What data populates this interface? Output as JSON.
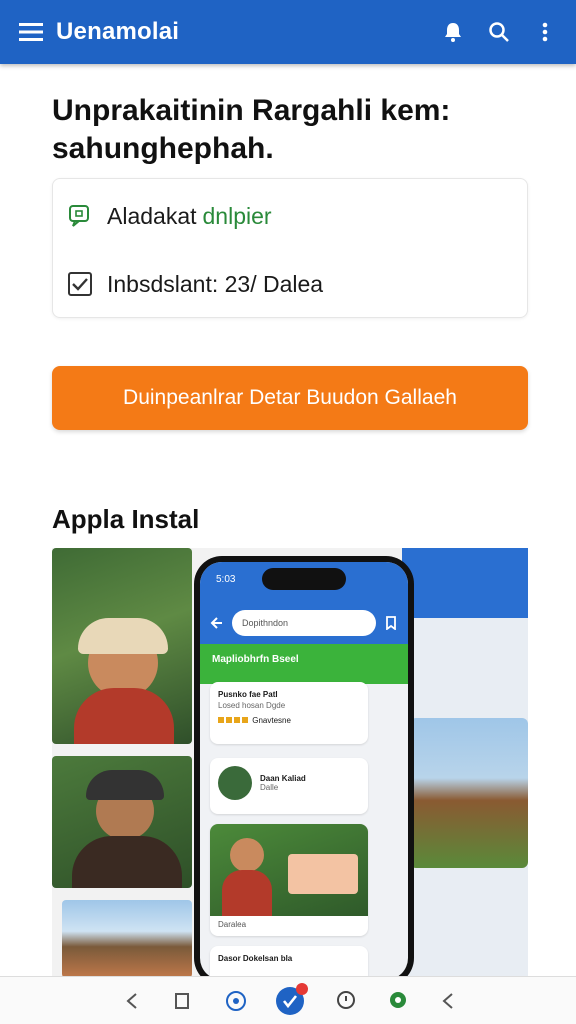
{
  "appbar": {
    "title": "Uenamolai",
    "menu_icon": "menu-icon",
    "actions": [
      "notification-bell-icon",
      "search-icon",
      "more-vert-icon"
    ],
    "color": "#1f63c4"
  },
  "headline": "Unprakaitinin Rargahli kem: sahunghephah.",
  "info": {
    "row1_label": "Aladakat",
    "row1_value": "dnlpier",
    "row1_icon": "chat-icon",
    "row2_text": "Inbsdslant: 23/ Dalea",
    "row2_icon": "checkbox-icon"
  },
  "cta": {
    "label": "Duinpeanlrar Detar Buudon Gallaeh",
    "color": "#f47a16"
  },
  "section_title": "Appla Instal",
  "phone": {
    "status_time": "5:03",
    "search_text": "Dopithndon",
    "green_banner": "Mapliobhrfn Bseel",
    "card1_title": "Pusnko fae Patl",
    "card1_sub": "Losed hosan Dgde",
    "card1_rating": "Gnavtesne",
    "card2_title": "Daan Kaliad",
    "card2_sub": "Dalle",
    "card3_caption": "Daralea",
    "card4_title": "Dasor Dokelsan bla"
  },
  "navbar": {
    "items": [
      "back-icon",
      "square-icon",
      "home-icon",
      "check-badge-icon",
      "chat-icon",
      "pin-icon",
      "back-icon"
    ]
  }
}
